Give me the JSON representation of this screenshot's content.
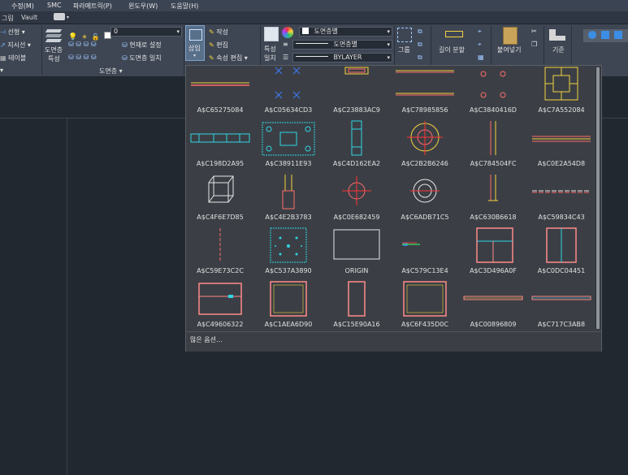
{
  "menu": [
    "수정(M)",
    "SMC",
    "파라메트릭(P)",
    "윈도우(W)",
    "도움말(H)"
  ],
  "tabs": [
    "그림",
    "Vault"
  ],
  "ribbon": {
    "draw": {
      "line_label": "선형",
      "leader_label": "지시선",
      "table_label": "테이블"
    },
    "layer": {
      "props_label_1": "도면층",
      "props_label_2": "특성",
      "current_layer": "0",
      "set_current_label": "현재로 설정",
      "match_layer_label": "도면층 일치",
      "panel_title": "도면층"
    },
    "block": {
      "insert_label": "삽입",
      "create_label": "작성",
      "edit_label": "편집",
      "attr_edit_label": "속성 편집"
    },
    "properties": {
      "match_label_1": "특성",
      "match_label_2": "일치",
      "color_value": "도면층별",
      "linetype_value": "도면층별",
      "lineweight_value": "BYLAYER"
    },
    "group": {
      "label": "그룹"
    },
    "utilities": {
      "measure_label": "길이 분할"
    },
    "clipboard": {
      "paste_label": "붙여넣기"
    },
    "view": {
      "base_label": "기준"
    }
  },
  "palette": {
    "blocks": [
      "A$C65275084",
      "A$C05634CD3",
      "A$C23883AC9",
      "A$C78985856",
      "A$C3840416D",
      "A$C7A552084",
      "A$C198D2A95",
      "A$C38911E93",
      "A$C4D162EA2",
      "A$C2B2B6246",
      "A$C784504FC",
      "A$C0E2A54D8",
      "A$C4F6E7D85",
      "A$C4E2B3783",
      "A$C0E682459",
      "A$C6ADB71C5",
      "A$C630B6618",
      "A$C59834C43",
      "A$C59E73C2C",
      "A$C537A3890",
      "ORIGIN",
      "A$C579C13E4",
      "A$C3D496A0F",
      "A$C0DC04451",
      "A$C49606322",
      "A$C1AEA6D90",
      "A$C15E90A16",
      "A$C6F435D0C",
      "A$C00896809",
      "A$C717C3AB8"
    ],
    "more_options": "많은 옵션..."
  }
}
